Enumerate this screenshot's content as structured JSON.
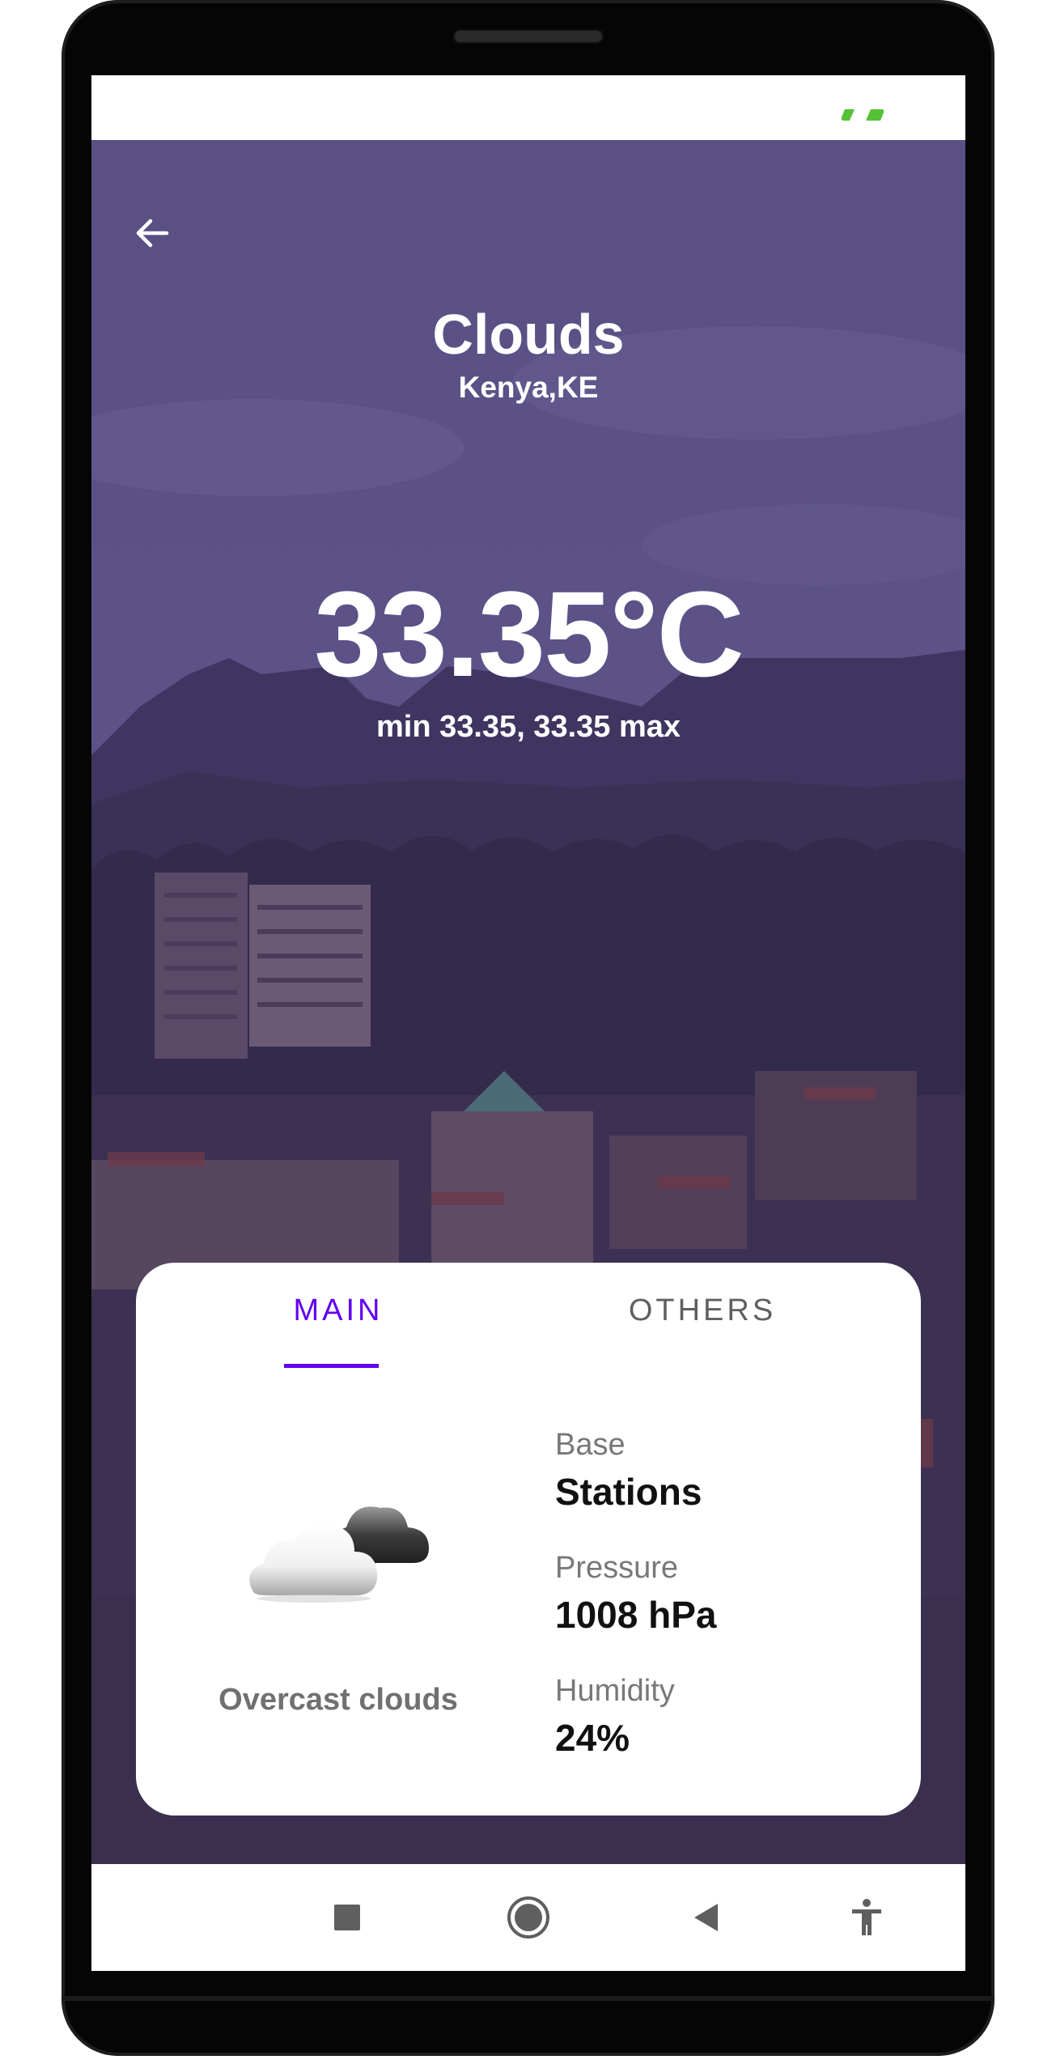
{
  "weather": {
    "condition": "Clouds",
    "location": "Kenya,KE",
    "temperature": "33.35°C",
    "min_max": "min 33.35, 33.35 max",
    "description": "Overcast clouds"
  },
  "tabs": [
    {
      "label": "MAIN",
      "selected": true
    },
    {
      "label": "OTHERS",
      "selected": false
    }
  ],
  "stats": [
    {
      "label": "Base",
      "value": "Stations"
    },
    {
      "label": "Pressure",
      "value": "1008 hPa"
    },
    {
      "label": "Humidity",
      "value": "24%"
    }
  ],
  "icons": {
    "back": "arrow-left-icon",
    "weather": "overcast-clouds-icon",
    "battery": "battery-icon",
    "nav": [
      "recents-square-icon",
      "home-circle-icon",
      "back-triangle-icon",
      "accessibility-icon"
    ]
  },
  "colors": {
    "accent": "#6200ee",
    "overlay": "#4a3d6e",
    "inactive_tab": "#5f5f5f",
    "battery": "#55c236"
  }
}
